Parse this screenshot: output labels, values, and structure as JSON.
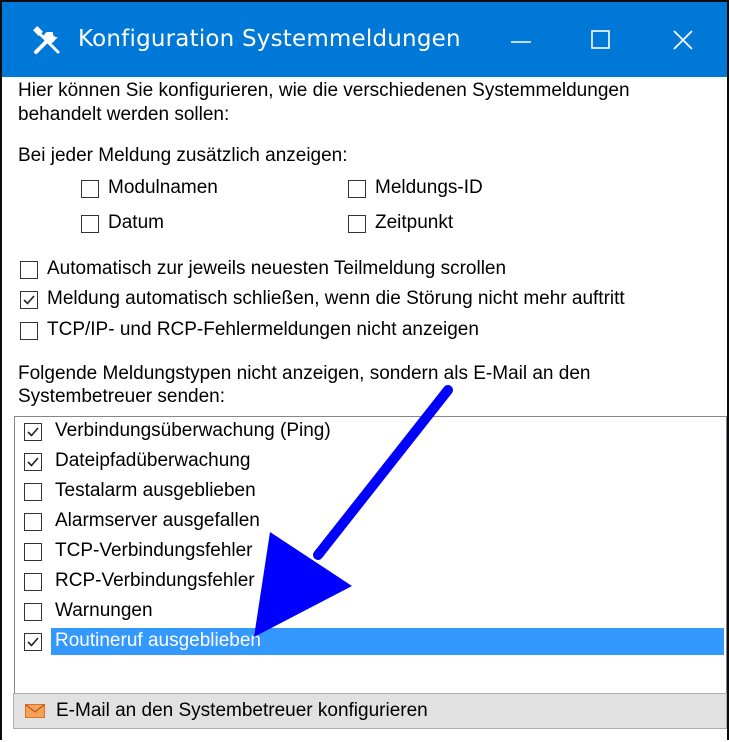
{
  "window": {
    "title": "Konfiguration Systemmeldungen",
    "icon": "tools-icon",
    "controls": [
      "minimize-icon",
      "maximize-icon",
      "close-icon"
    ]
  },
  "intro_text": {
    "line1": "Hier können Sie konfigurieren, wie die verschiedenen Systemmeldungen",
    "line2": "behandelt werden sollen:"
  },
  "extra_display": {
    "heading": "Bei jeder Meldung zusätzlich anzeigen:",
    "options": [
      {
        "label": "Modulnamen",
        "checked": false
      },
      {
        "label": "Meldungs-ID",
        "checked": false
      },
      {
        "label": "Datum",
        "checked": false
      },
      {
        "label": "Zeitpunkt",
        "checked": false
      }
    ]
  },
  "general_options": [
    {
      "label": "Automatisch zur jeweils neuesten Teilmeldung scrollen",
      "checked": false
    },
    {
      "label": "Meldung automatisch schließen, wenn die Störung nicht mehr auftritt",
      "checked": true
    },
    {
      "label": "TCP/IP- und RCP-Fehlermeldungen nicht anzeigen",
      "checked": false
    }
  ],
  "email_section": {
    "line1": "Folgende Meldungstypen nicht anzeigen, sondern als E-Mail an den",
    "line2": "Systembetreuer senden:"
  },
  "message_types": [
    {
      "label": "Verbindungsüberwachung (Ping)",
      "checked": true,
      "selected": false
    },
    {
      "label": "Dateipfadüberwachung",
      "checked": true,
      "selected": false
    },
    {
      "label": "Testalarm ausgeblieben",
      "checked": false,
      "selected": false
    },
    {
      "label": "Alarmserver ausgefallen",
      "checked": false,
      "selected": false
    },
    {
      "label": "TCP-Verbindungsfehler",
      "checked": false,
      "selected": false
    },
    {
      "label": "RCP-Verbindungsfehler",
      "checked": false,
      "selected": false
    },
    {
      "label": "Warnungen",
      "checked": false,
      "selected": false
    },
    {
      "label": "Routineruf ausgeblieben",
      "checked": true,
      "selected": true
    }
  ],
  "configure_button": {
    "label": "E-Mail an den Systembetreuer konfigurieren",
    "icon": "envelope-icon"
  },
  "colors": {
    "titlebar": "#0078d7",
    "selection": "#3399ff",
    "annotation_arrow": "#0000ff"
  }
}
